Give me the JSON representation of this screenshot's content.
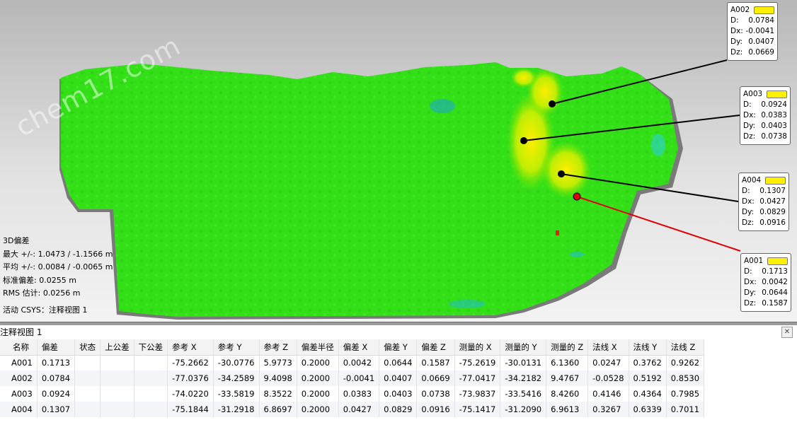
{
  "watermark": "chem17.com",
  "stats": {
    "title": "3D偏差",
    "max": "最大 +/-: 1.0473 / -1.1566 m",
    "avg": "平均 +/-: 0.0084 / -0.0065 m",
    "std": "标准偏差: 0.0255 m",
    "rms": "RMS 估计:  0.0256 m",
    "csys": "活动 CSYS：注释视图 1"
  },
  "callouts": [
    {
      "id": "A002",
      "d": "0.0784",
      "dx": "-0.0041",
      "dy": "0.0407",
      "dz": "0.0669"
    },
    {
      "id": "A003",
      "d": "0.0924",
      "dx": "0.0383",
      "dy": "0.0403",
      "dz": "0.0738"
    },
    {
      "id": "A004",
      "d": "0.1307",
      "dx": "0.0427",
      "dy": "0.0829",
      "dz": "0.0916"
    },
    {
      "id": "A001",
      "d": "0.1713",
      "dx": "0.0042",
      "dy": "0.0644",
      "dz": "0.1587"
    }
  ],
  "labels": {
    "d": "D:",
    "dx": "Dx:",
    "dy": "Dy:",
    "dz": "Dz:"
  },
  "colors": {
    "callout_swatch": "#ffef00",
    "leader_default": "#000000",
    "leader_selected": "#e00000",
    "surface": "#33e018"
  },
  "panel": {
    "title": "注释视图 1",
    "close_icon": "✕"
  },
  "table": {
    "headers": [
      "名称",
      "偏差",
      "状态",
      "上公差",
      "下公差",
      "参考 X",
      "参考 Y",
      "参考 Z",
      "偏差半径",
      "偏差 X",
      "偏差 Y",
      "偏差 Z",
      "测量的 X",
      "测量的 Y",
      "测量的 Z",
      "法线 X",
      "法线 Y",
      "法线 Z"
    ],
    "rows": [
      [
        "A001",
        "0.1713",
        "",
        "",
        "",
        "-75.2662",
        "-30.0776",
        "5.9773",
        "0.2000",
        "0.0042",
        "0.0644",
        "0.1587",
        "-75.2619",
        "-30.0131",
        "6.1360",
        "0.0247",
        "0.3762",
        "0.9262"
      ],
      [
        "A002",
        "0.0784",
        "",
        "",
        "",
        "-77.0376",
        "-34.2589",
        "9.4098",
        "0.2000",
        "-0.0041",
        "0.0407",
        "0.0669",
        "-77.0417",
        "-34.2182",
        "9.4767",
        "-0.0528",
        "0.5192",
        "0.8530"
      ],
      [
        "A003",
        "0.0924",
        "",
        "",
        "",
        "-74.0220",
        "-33.5819",
        "8.3522",
        "0.2000",
        "0.0383",
        "0.0403",
        "0.0738",
        "-73.9837",
        "-33.5416",
        "8.4260",
        "0.4146",
        "0.4364",
        "0.7985"
      ],
      [
        "A004",
        "0.1307",
        "",
        "",
        "",
        "-75.1844",
        "-31.2918",
        "6.8697",
        "0.2000",
        "0.0427",
        "0.0829",
        "0.0916",
        "-75.1417",
        "-31.2090",
        "6.9613",
        "0.3267",
        "0.6339",
        "0.7011"
      ]
    ]
  }
}
